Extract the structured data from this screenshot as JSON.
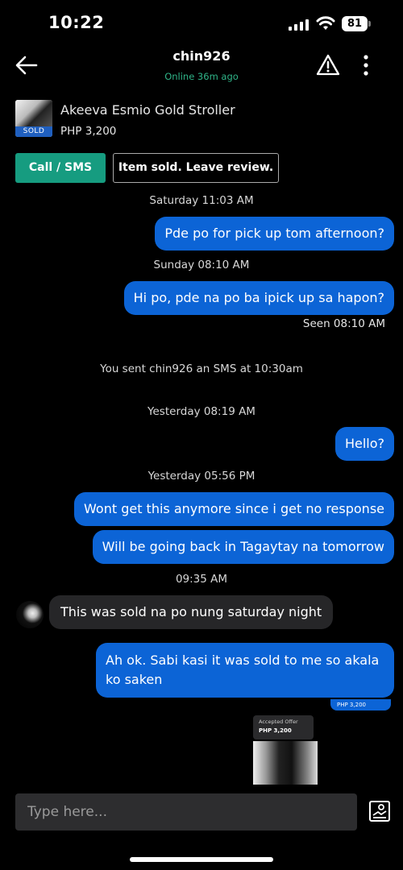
{
  "status_bar": {
    "time": "10:22",
    "battery": "81"
  },
  "header": {
    "username": "chin926",
    "status": "Online 36m ago"
  },
  "listing": {
    "title": "Akeeva Esmio Gold Stroller",
    "price": "PHP 3,200",
    "badge": "SOLD"
  },
  "actions": {
    "call_label": "Call / SMS",
    "review_label": "Item sold. Leave review."
  },
  "messages": [
    {
      "type": "time",
      "text": "Saturday 11:03 AM"
    },
    {
      "type": "out",
      "text": "Pde po for pick up tom afternoon?"
    },
    {
      "type": "time",
      "text": "Sunday 08:10 AM"
    },
    {
      "type": "out",
      "text": "Hi po, pde na po ba ipick up sa hapon?"
    },
    {
      "type": "seen",
      "text": "Seen 08:10 AM"
    },
    {
      "type": "system",
      "text": "You sent chin926 an SMS at 10:30am"
    },
    {
      "type": "time",
      "text": "Yesterday 08:19 AM"
    },
    {
      "type": "out",
      "text": "Hello?"
    },
    {
      "type": "time",
      "text": "Yesterday 05:56 PM"
    },
    {
      "type": "out",
      "text": "Wont get this anymore since i get no response"
    },
    {
      "type": "out",
      "text": "Will be going back in Tagaytay na tomorrow"
    },
    {
      "type": "time",
      "text": "09:35 AM"
    },
    {
      "type": "in",
      "text": "This was sold na po nung saturday night"
    },
    {
      "type": "out",
      "text": "Ah ok. Sabi kasi it was sold to me so akala ko saken"
    }
  ],
  "offer": {
    "strip_price": "PHP 3,200",
    "label": "Accepted Offer",
    "price": "PHP 3,200"
  },
  "composer": {
    "placeholder": "Type here..."
  },
  "icons": {
    "back": "arrow-left-icon",
    "report": "warning-triangle-icon",
    "more": "more-vertical-icon",
    "photo": "image-upload-icon"
  },
  "colors": {
    "outgoing_bubble": "#0c64d6",
    "incoming_bubble": "#262628",
    "accent_green": "#169c80",
    "online_green": "#2fb488"
  }
}
